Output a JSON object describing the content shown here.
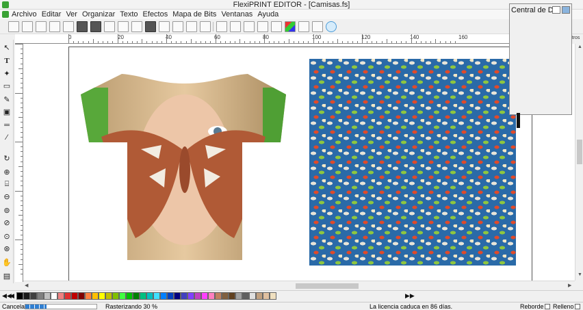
{
  "window": {
    "title": "FlexiPRINT EDITOR - [Camisas.fs]"
  },
  "menu": [
    "Archivo",
    "Editar",
    "Ver",
    "Organizar",
    "Texto",
    "Efectos",
    "Mapa de Bits",
    "Ventanas",
    "Ayuda"
  ],
  "ruler": {
    "labels": [
      "0",
      "20",
      "40",
      "60",
      "80",
      "100",
      "120",
      "140",
      "160"
    ],
    "unit": "metros"
  },
  "docker": {
    "title": "Central de Diseño"
  },
  "status": {
    "cancel_label": "Cancelar",
    "progress": 0.3,
    "task_text": "Rasterizando 30 %",
    "license_text": "La licencia caduca en 86 días.",
    "outline_label": "Reborde",
    "fill_label": "Relleno"
  },
  "colors": {
    "accent": "#3aa235",
    "pattern_bg": "#2a6aa8",
    "palette": [
      "#000000",
      "#1a1a1a",
      "#404040",
      "#808080",
      "#c0c0c0",
      "#ffffff",
      "#f08080",
      "#e03030",
      "#c00000",
      "#800000",
      "#ff8040",
      "#ffc000",
      "#ffff00",
      "#c0c000",
      "#80c000",
      "#40ff40",
      "#00c000",
      "#008000",
      "#00c080",
      "#00c0c0",
      "#40e0ff",
      "#0080ff",
      "#0040c0",
      "#000080",
      "#4040c0",
      "#8040ff",
      "#c040c0",
      "#ff40ff",
      "#ff80c0",
      "#c08060",
      "#806040",
      "#604020",
      "#a0a0a0",
      "#606060",
      "#e0e0e0",
      "#c0a080",
      "#e0c0a0",
      "#f0e0c0"
    ]
  },
  "toolbox_icons": [
    "pointer-icon",
    "text-icon",
    "shape-icon",
    "rectangle-icon",
    "pen-icon",
    "crop-icon",
    "ruler-icon",
    "eyedropper-icon",
    "rotate-icon",
    "zoom-in-icon",
    "pan-icon",
    "zoom-out-icon",
    "zoom-fit-icon",
    "magic-icon",
    "magnifier-icon",
    "zoom-all-icon",
    "hand-icon",
    "fill-icon"
  ]
}
